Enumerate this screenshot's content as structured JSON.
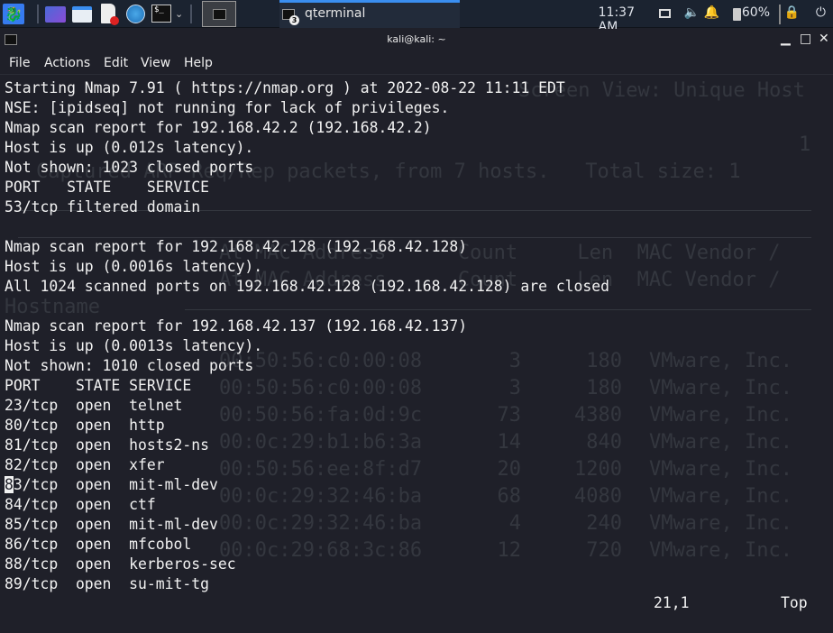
{
  "taskbar": {
    "launchers": [
      {
        "icon": "kali-menu-icon"
      },
      {
        "icon": "desktop-icon"
      },
      {
        "icon": "file-manager-icon"
      },
      {
        "icon": "text-editor-icon"
      },
      {
        "icon": "browser-icon"
      },
      {
        "icon": "terminal-icon",
        "glyph": "$_"
      }
    ],
    "chevron": "⌄",
    "task": {
      "label": "qterminal",
      "badge": "3"
    },
    "clock": "11:37 AM",
    "battery": "60%",
    "accent": "#3a8ef0"
  },
  "window": {
    "title": "kali@kali: ~",
    "minimize": "▁",
    "maximize": "□",
    "close": "✕"
  },
  "menu": [
    "File",
    "Actions",
    "Edit",
    "View",
    "Help"
  ],
  "terminal": {
    "lines": [
      "Starting Nmap 7.91 ( https://nmap.org ) at 2022-08-22 11:11 EDT",
      "NSE: [ipidseq] not running for lack of privileges.",
      "Nmap scan report for 192.168.42.2 (192.168.42.2)",
      "Host is up (0.012s latency).",
      "Not shown: 1023 closed ports",
      "PORT   STATE    SERVICE",
      "53/tcp filtered domain",
      "",
      "Nmap scan report for 192.168.42.128 (192.168.42.128)",
      "Host is up (0.0016s latency).",
      "All 1024 scanned ports on 192.168.42.128 (192.168.42.128) are closed",
      "",
      "Nmap scan report for 192.168.42.137 (192.168.42.137)",
      "Host is up (0.0013s latency).",
      "Not shown: 1010 closed ports",
      "PORT    STATE SERVICE",
      "23/tcp  open  telnet",
      "80/tcp  open  http",
      "81/tcp  open  hosts2-ns",
      "82/tcp  open  xfer",
      "83/tcp  open  mit-ml-dev",
      "84/tcp  open  ctf",
      "85/tcp  open  mit-ml-dev",
      "86/tcp  open  mfcobol",
      "88/tcp  open  kerberos-sec",
      "89/tcp  open  su-mit-tg"
    ],
    "cursor_char": "8",
    "cursor_rest": "3/tcp  open  mit-ml-dev",
    "status_position": "21,1",
    "status_scroll": "Top"
  },
  "background_window": {
    "header": [
      "Screen View: Unique Host",
      "1",
      "Captured ARP Req/Rep packets, from 7 hosts.   Total size: 1",
      "Hostname"
    ],
    "columns": "At MAC Address      Count     Len  MAC Vendor /",
    "rows": [
      [
        "00:50:56:c0:00:08",
        "3",
        "180",
        "VMware, Inc."
      ],
      [
        "00:50:56:c0:00:08",
        "3",
        "180",
        "VMware, Inc."
      ],
      [
        "00:50:56:fa:0d:9c",
        "73",
        "4380",
        "VMware, Inc."
      ],
      [
        "00:0c:29:b1:b6:3a",
        "14",
        "840",
        "VMware, Inc."
      ],
      [
        "00:50:56:ee:8f:d7",
        "20",
        "1200",
        "VMware, Inc."
      ],
      [
        "00:0c:29:32:46:ba",
        "68",
        "4080",
        "VMware, Inc."
      ],
      [
        "00:0c:29:32:46:ba",
        "4",
        "240",
        "VMware, Inc."
      ],
      [
        "00:0c:29:68:3c:86",
        "12",
        "720",
        "VMware, Inc."
      ]
    ]
  }
}
